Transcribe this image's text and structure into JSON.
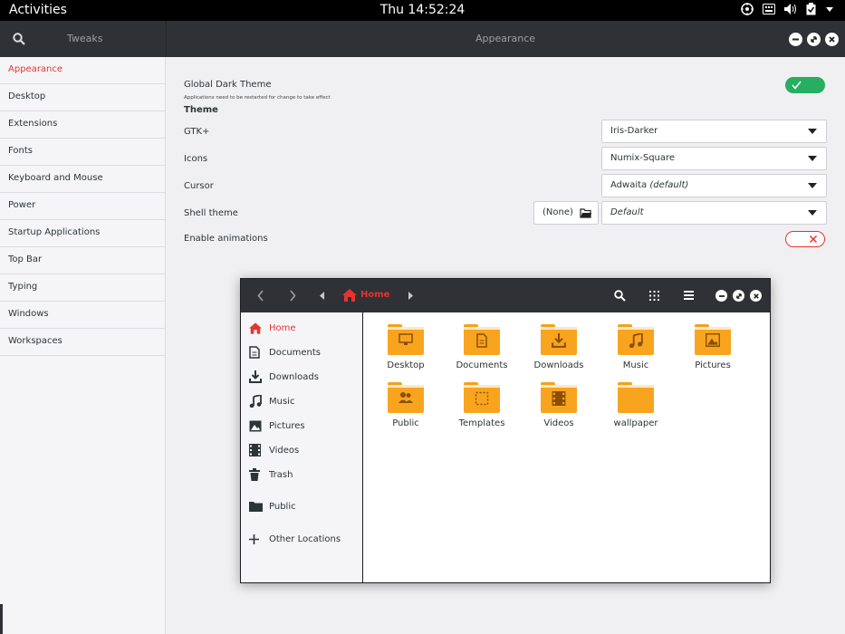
{
  "topbar": {
    "activities": "Activities",
    "clock": "Thu 14:52:24"
  },
  "header": {
    "app_name": "Tweaks",
    "page_title": "Appearance"
  },
  "sidebar": {
    "items": [
      {
        "label": "Appearance",
        "active": true
      },
      {
        "label": "Desktop"
      },
      {
        "label": "Extensions"
      },
      {
        "label": "Fonts"
      },
      {
        "label": "Keyboard and Mouse"
      },
      {
        "label": "Power"
      },
      {
        "label": "Startup Applications"
      },
      {
        "label": "Top Bar"
      },
      {
        "label": "Typing"
      },
      {
        "label": "Windows"
      },
      {
        "label": "Workspaces"
      }
    ]
  },
  "appearance": {
    "global_dark_label": "Global Dark Theme",
    "global_dark_note": "Applications need to be restarted for change to take effect",
    "global_dark_on": true,
    "theme_heading": "Theme",
    "gtk_label": "GTK+",
    "gtk_value": "Iris-Darker",
    "icons_label": "Icons",
    "icons_value": "Numix-Square",
    "cursor_label": "Cursor",
    "cursor_value": "Adwaita",
    "cursor_suffix": "(default)",
    "shell_label": "Shell theme",
    "shell_file": "(None)",
    "shell_value": "Default",
    "animations_label": "Enable animations",
    "animations_on": false
  },
  "files": {
    "path_label": "Home",
    "sidebar": [
      {
        "label": "Home",
        "icon": "home-icon",
        "active": true
      },
      {
        "label": "Documents",
        "icon": "document-icon"
      },
      {
        "label": "Downloads",
        "icon": "download-icon"
      },
      {
        "label": "Music",
        "icon": "music-icon"
      },
      {
        "label": "Pictures",
        "icon": "picture-icon"
      },
      {
        "label": "Videos",
        "icon": "video-icon"
      },
      {
        "label": "Trash",
        "icon": "trash-icon"
      },
      {
        "label": "Public",
        "icon": "folder-icon"
      },
      {
        "label": "Other Locations",
        "icon": "plus-icon"
      }
    ],
    "folders": [
      {
        "label": "Desktop",
        "icon": "desktop-icon"
      },
      {
        "label": "Documents",
        "icon": "document-icon"
      },
      {
        "label": "Downloads",
        "icon": "download-icon"
      },
      {
        "label": "Music",
        "icon": "music-icon"
      },
      {
        "label": "Pictures",
        "icon": "picture-icon"
      },
      {
        "label": "Public",
        "icon": "people-icon"
      },
      {
        "label": "Templates",
        "icon": "template-icon"
      },
      {
        "label": "Videos",
        "icon": "video-icon"
      },
      {
        "label": "wallpaper",
        "icon": "folder-icon"
      }
    ]
  },
  "colors": {
    "accent": "#e8332e",
    "toggle_on": "#27ae60",
    "folder": "#f8a41f",
    "header": "#2f3136"
  }
}
